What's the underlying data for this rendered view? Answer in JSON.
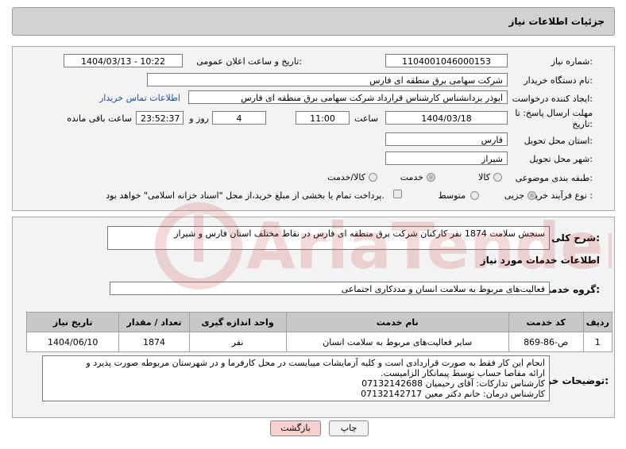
{
  "header": {
    "title": "جزئیات اطلاعات نیاز"
  },
  "form": {
    "need_number_label": "شماره نیاز:",
    "need_number": "1104001046000153",
    "announce_label": "تاریخ و ساعت اعلان عمومی:",
    "announce_value": "1404/03/13 - 10:22",
    "buyer_label": "نام دستگاه خریدار:",
    "buyer_value": "شرکت سهامی برق منطقه ای فارس",
    "creator_label": "ایجاد کننده درخواست:",
    "creator_value": "ایوذر  یزدانشناس کارشناس قرارداد شرکت سهامی برق منطقه ای فارس",
    "contact_link": "اطلاعات تماس خریدار",
    "deadline_label_1": "مهلت ارسال پاسخ: تا",
    "deadline_label_2": "تاریخ:",
    "deadline_date": "1404/03/18",
    "time_label": "ساعت",
    "deadline_time": "11:00",
    "days_value": "4",
    "days_label": "روز و",
    "remaining_value": "23:52:37",
    "remaining_label": "ساعت باقی مانده",
    "province_label": "استان محل تحویل:",
    "province_value": "فارس",
    "city_label": "شهر محل تحویل:",
    "city_value": "شیراز",
    "category_label": "طبقه بندی موضوعی:",
    "category_options": [
      "کالا",
      "خدمت",
      "کالا/خدمت"
    ],
    "category_selected": "خدمت",
    "process_label": "نوع فرآیند خرید :",
    "process_options": [
      "جزیی",
      "متوسط"
    ],
    "process_selected": "جزیی",
    "payment_note": "پرداخت تمام یا بخشی از مبلغ خرید،از محل \"اسناد خزانه اسلامی\" خواهد بود."
  },
  "summary": {
    "label": "شرح کلی نیاز:",
    "value": "سنجش سلامت 1874 نفر کارکنان شرکت برق منطقه ای فارس در نقاط مختلف استان فارس و شیراز"
  },
  "services": {
    "section_title": "اطلاعات خدمات مورد نیاز",
    "group_label": "گروه خدمت:",
    "group_value": "فعالیت‌های مربوط به سلامت انسان و مددکاری اجتماعی",
    "columns": [
      "ردیف",
      "کد خدمت",
      "نام خدمت",
      "واحد اندازه گیری",
      "تعداد / مقدار",
      "تاریخ نیاز"
    ],
    "rows": [
      [
        "1",
        "ص-86-869",
        "سایر فعالیت‌های مربوط به سلامت انسان",
        "نفر",
        "1874",
        "1404/06/10"
      ]
    ]
  },
  "buyer_notes": {
    "label": "توضیحات خریدار:",
    "lines": [
      "انجام این کار فقط به صورت قراردادی است و کلیه آزمایشات میبایست در محل کارفرما و در شهرستان مربوطه صورت پذیرد و",
      "ارائه مفاصا حساب توسط پیمانکار الزامیست.",
      "کارشناس تدارکات: آقای رحیمیان 07132142688",
      "کارشناس درمان: خانم دکتر معین 07132142717"
    ]
  },
  "buttons": {
    "print": "چاپ",
    "back": "بازگشت"
  },
  "colors": {
    "header_bg": "#d2d2d2",
    "link": "#1a4fa8",
    "back_button_bg": "#f7d0d0",
    "table_header_bg": "#c8c8c8"
  }
}
